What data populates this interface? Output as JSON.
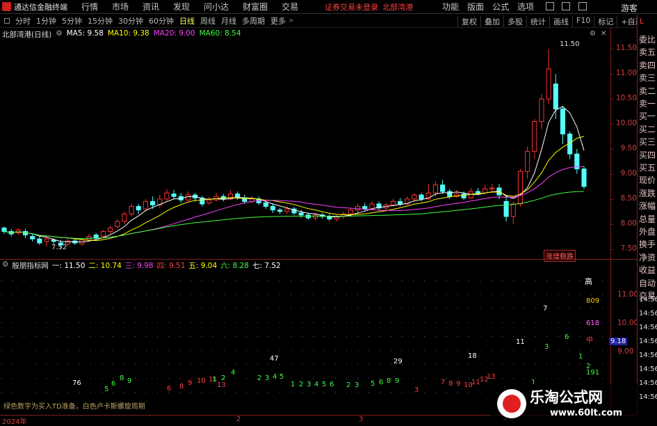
{
  "app": {
    "title": "通达信金融终端"
  },
  "menu": [
    "行情",
    "市场",
    "资讯",
    "发现",
    "问小达",
    "财富圈",
    "交易"
  ],
  "status_left": "证券交易未登录",
  "status_right": "北部湾港",
  "right_menu": [
    "功能",
    "版面",
    "公式",
    "选项",
    "游客"
  ],
  "periods": [
    "分时",
    "1分钟",
    "5分钟",
    "15分钟",
    "30分钟",
    "60分钟",
    "日线",
    "周线",
    "月线",
    "多周期",
    "更多"
  ],
  "active_period": "日线",
  "toolbar_right": [
    "复权",
    "叠加",
    "多股",
    "统计",
    "画线",
    "F10",
    "标记",
    "+自选"
  ],
  "stock_header": "北部湾港(日线)",
  "ma": [
    {
      "name": "MA5",
      "value": "9.58",
      "color": "#ffffff"
    },
    {
      "name": "MA10",
      "value": "9.38",
      "color": "#ffff00"
    },
    {
      "name": "MA20",
      "value": "9.00",
      "color": "#ff40ff"
    },
    {
      "name": "MA60",
      "value": "8.54",
      "color": "#40ff40"
    }
  ],
  "price_axis": [
    "11.50",
    "11.00",
    "10.50",
    "10.00",
    "9.50",
    "9.00",
    "8.50",
    "8.00",
    "7.50"
  ],
  "high_label": "11.50",
  "low_label": "7.52",
  "tag": "涨增稳跌",
  "side_panel": [
    "委比",
    "卖五",
    "卖四",
    "卖三",
    "卖二",
    "卖一",
    "买一",
    "买二",
    "买三",
    "买四",
    "买五",
    "现价",
    "涨跌",
    "涨幅",
    "总量",
    "外盘",
    "换手",
    "净资",
    "收益",
    "自动",
    "交易"
  ],
  "side_times": [
    "14:56",
    "14:56",
    "14:56",
    "14:56",
    "14:56",
    "14:56",
    "14:56",
    "14:56"
  ],
  "indicator": {
    "name": "殷朋指标网",
    "items": [
      {
        "name": "一",
        "value": "11.50",
        "color": "#ffffff"
      },
      {
        "name": "二",
        "value": "10.74",
        "color": "#ffff00"
      },
      {
        "name": "三",
        "value": "9.98",
        "color": "#ff40ff"
      },
      {
        "name": "四",
        "value": "9.51",
        "color": "#ff4040"
      },
      {
        "name": "五",
        "value": "9.04",
        "color": "#ffff00"
      },
      {
        "name": "六",
        "value": "8.28",
        "color": "#40ff40"
      },
      {
        "name": "七",
        "value": "7.52",
        "color": "#ffffff"
      }
    ],
    "axis": [
      "11.00",
      "10.00",
      "9.00"
    ],
    "tags": {
      "high": "高",
      "v809": "809",
      "v618": "618",
      "mid": "中",
      "v191": "191",
      "price": "9.18"
    },
    "note": "绿色数字为买入TD准备，白色卢卡斯螺旋周期"
  },
  "counts": {
    "c76": "76",
    "c47": "47",
    "c29": "29",
    "c18": "18",
    "c11": "11",
    "c7": "7"
  },
  "date_axis": [
    "2024年",
    "2",
    "3",
    "4"
  ],
  "watermark": {
    "title": "乐淘公式网",
    "url": "www.60lt.com"
  },
  "chart_data": {
    "type": "candlestick",
    "ylim": [
      7.3,
      11.7
    ],
    "candles": [
      [
        7.92,
        7.85,
        7.95,
        7.8
      ],
      [
        7.85,
        7.8,
        7.9,
        7.75
      ],
      [
        7.82,
        7.88,
        7.92,
        7.78
      ],
      [
        7.85,
        7.78,
        7.9,
        7.72
      ],
      [
        7.75,
        7.7,
        7.8,
        7.65
      ],
      [
        7.7,
        7.62,
        7.75,
        7.58
      ],
      [
        7.65,
        7.7,
        7.75,
        7.55
      ],
      [
        7.68,
        7.65,
        7.72,
        7.6
      ],
      [
        7.62,
        7.58,
        7.68,
        7.52
      ],
      [
        7.6,
        7.66,
        7.7,
        7.55
      ],
      [
        7.66,
        7.62,
        7.7,
        7.58
      ],
      [
        7.6,
        7.68,
        7.72,
        7.57
      ],
      [
        7.68,
        7.75,
        7.8,
        7.64
      ],
      [
        7.78,
        7.72,
        7.82,
        7.68
      ],
      [
        7.75,
        7.85,
        7.88,
        7.7
      ],
      [
        7.85,
        7.92,
        7.96,
        7.8
      ],
      [
        7.95,
        8.05,
        8.1,
        7.9
      ],
      [
        8.05,
        8.2,
        8.25,
        8.0
      ],
      [
        8.2,
        8.35,
        8.4,
        8.15
      ],
      [
        8.35,
        8.28,
        8.4,
        8.2
      ],
      [
        8.3,
        8.45,
        8.5,
        8.25
      ],
      [
        8.45,
        8.38,
        8.55,
        8.3
      ],
      [
        8.38,
        8.5,
        8.58,
        8.32
      ],
      [
        8.5,
        8.62,
        8.7,
        8.45
      ],
      [
        8.6,
        8.55,
        8.68,
        8.5
      ],
      [
        8.55,
        8.48,
        8.62,
        8.42
      ],
      [
        8.48,
        8.58,
        8.65,
        8.45
      ],
      [
        8.58,
        8.52,
        8.62,
        8.45
      ],
      [
        8.52,
        8.4,
        8.56,
        8.35
      ],
      [
        8.42,
        8.48,
        8.55,
        8.38
      ],
      [
        8.48,
        8.55,
        8.62,
        8.45
      ],
      [
        8.55,
        8.5,
        8.6,
        8.45
      ],
      [
        8.5,
        8.6,
        8.68,
        8.48
      ],
      [
        8.6,
        8.52,
        8.65,
        8.48
      ],
      [
        8.52,
        8.45,
        8.58,
        8.4
      ],
      [
        8.45,
        8.5,
        8.56,
        8.42
      ],
      [
        8.5,
        8.42,
        8.55,
        8.38
      ],
      [
        8.42,
        8.35,
        8.48,
        8.3
      ],
      [
        8.35,
        8.28,
        8.4,
        8.22
      ],
      [
        8.28,
        8.25,
        8.32,
        8.2
      ],
      [
        8.25,
        8.3,
        8.36,
        8.2
      ],
      [
        8.3,
        8.22,
        8.34,
        8.18
      ],
      [
        8.22,
        8.18,
        8.28,
        8.12
      ],
      [
        8.18,
        8.12,
        8.22,
        8.08
      ],
      [
        8.12,
        8.18,
        8.22,
        8.08
      ],
      [
        8.18,
        8.15,
        8.22,
        8.1
      ],
      [
        8.15,
        8.1,
        8.2,
        8.06
      ],
      [
        8.1,
        8.15,
        8.18,
        8.05
      ],
      [
        8.15,
        8.2,
        8.25,
        8.1
      ],
      [
        8.2,
        8.28,
        8.32,
        8.15
      ],
      [
        8.28,
        8.35,
        8.4,
        8.22
      ],
      [
        8.35,
        8.3,
        8.42,
        8.26
      ],
      [
        8.3,
        8.4,
        8.45,
        8.28
      ],
      [
        8.4,
        8.32,
        8.45,
        8.28
      ],
      [
        8.32,
        8.38,
        8.42,
        8.28
      ],
      [
        8.38,
        8.45,
        8.5,
        8.35
      ],
      [
        8.45,
        8.4,
        8.52,
        8.36
      ],
      [
        8.4,
        8.5,
        8.55,
        8.38
      ],
      [
        8.5,
        8.58,
        8.62,
        8.45
      ],
      [
        8.58,
        8.5,
        8.62,
        8.45
      ],
      [
        8.5,
        8.62,
        8.8,
        8.48
      ],
      [
        8.62,
        8.78,
        8.85,
        8.55
      ],
      [
        8.78,
        8.65,
        8.88,
        8.6
      ],
      [
        8.65,
        8.55,
        8.7,
        8.5
      ],
      [
        8.55,
        8.6,
        8.68,
        8.52
      ],
      [
        8.6,
        8.52,
        8.65,
        8.48
      ],
      [
        8.52,
        8.65,
        8.72,
        8.5
      ],
      [
        8.65,
        8.62,
        8.72,
        8.58
      ],
      [
        8.62,
        8.7,
        8.78,
        8.58
      ],
      [
        8.7,
        8.72,
        8.8,
        8.62
      ],
      [
        8.72,
        8.58,
        8.8,
        8.5
      ],
      [
        8.45,
        8.15,
        8.55,
        8.05
      ],
      [
        8.15,
        8.4,
        8.45,
        8.0
      ],
      [
        8.4,
        9.05,
        9.1,
        8.35
      ],
      [
        9.05,
        9.45,
        9.55,
        8.9
      ],
      [
        9.45,
        10.05,
        10.1,
        9.3
      ],
      [
        10.05,
        10.5,
        10.6,
        9.9
      ],
      [
        10.5,
        11.1,
        11.5,
        10.4
      ],
      [
        10.8,
        10.3,
        11.0,
        10.1
      ],
      [
        10.3,
        9.8,
        10.35,
        9.6
      ],
      [
        9.8,
        9.4,
        9.85,
        9.3
      ],
      [
        9.4,
        9.1,
        9.5,
        9.0
      ],
      [
        9.1,
        8.75,
        9.15,
        8.7
      ]
    ]
  }
}
